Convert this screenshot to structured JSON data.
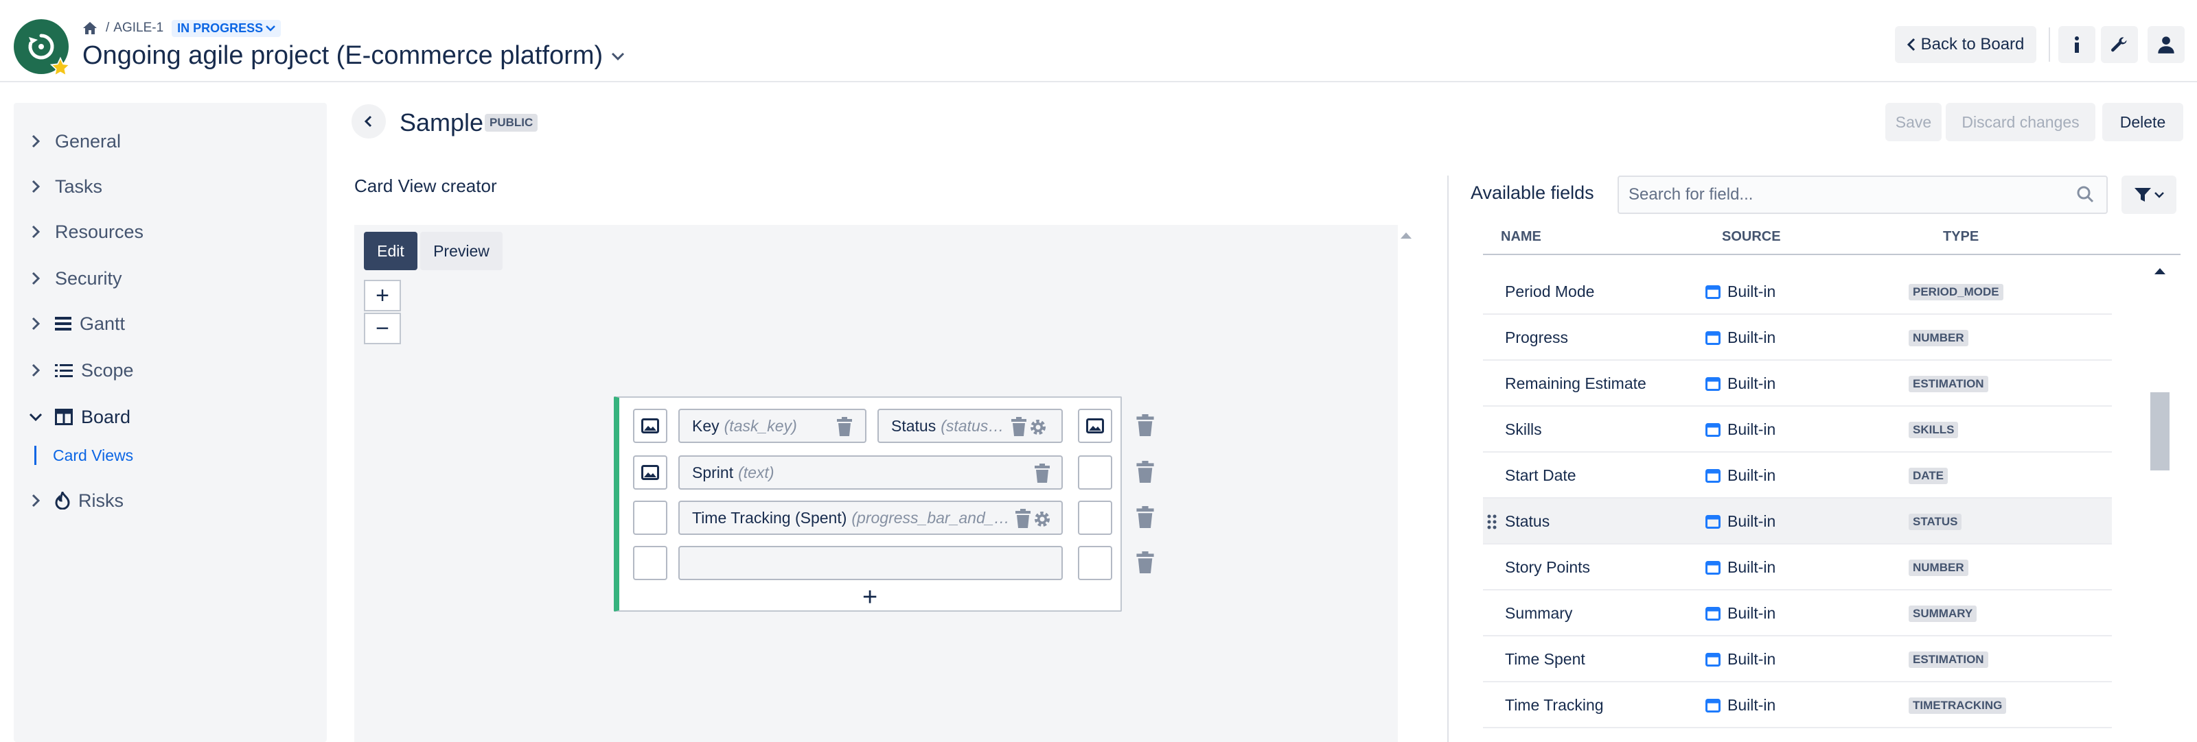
{
  "header": {
    "breadcrumb_sep": "/",
    "project_key": "AGILE-1",
    "status": "IN PROGRESS",
    "project_title": "Ongoing agile project (E-commerce platform)",
    "back_to_board": "Back to Board",
    "icons": [
      "home-icon",
      "info-icon",
      "wrench-icon",
      "user-icon"
    ]
  },
  "sidebar": {
    "items": [
      {
        "label": "General",
        "icon": null
      },
      {
        "label": "Tasks",
        "icon": null
      },
      {
        "label": "Resources",
        "icon": null
      },
      {
        "label": "Security",
        "icon": null
      },
      {
        "label": "Gantt",
        "icon": "gantt-icon"
      },
      {
        "label": "Scope",
        "icon": "list-icon"
      },
      {
        "label": "Board",
        "icon": "board-icon",
        "expanded": true
      },
      {
        "label": "Risks",
        "icon": "fire-icon"
      }
    ],
    "sub_item": "Card Views"
  },
  "editor": {
    "view_name": "Sample",
    "visibility": "PUBLIC",
    "save": "Save",
    "discard": "Discard changes",
    "delete": "Delete",
    "creator_label": "Card View creator",
    "tabs": {
      "edit": "Edit",
      "preview": "Preview"
    },
    "zoom_in": "+",
    "zoom_out": "−",
    "add_row": "+",
    "card": {
      "rows": [
        {
          "fields": [
            {
              "name": "Key",
              "type": "(task_key)",
              "settings": false
            },
            {
              "name": "Status",
              "type": "(status_…",
              "settings": true
            }
          ]
        },
        {
          "fields": [
            {
              "name": "Sprint",
              "type": "(text)",
              "settings": false
            }
          ]
        },
        {
          "fields": [
            {
              "name": "Time Tracking (Spent)",
              "type": "(progress_bar_and_p…",
              "settings": true
            }
          ]
        },
        {
          "fields": []
        }
      ]
    }
  },
  "fields_panel": {
    "title": "Available fields",
    "search_placeholder": "Search for field...",
    "columns": {
      "name": "NAME",
      "source": "SOURCE",
      "type": "TYPE"
    },
    "rows": [
      {
        "name": "Period Mode",
        "source": "Built-in",
        "type": "PERIOD_MODE"
      },
      {
        "name": "Progress",
        "source": "Built-in",
        "type": "NUMBER"
      },
      {
        "name": "Remaining Estimate",
        "source": "Built-in",
        "type": "ESTIMATION"
      },
      {
        "name": "Skills",
        "source": "Built-in",
        "type": "SKILLS"
      },
      {
        "name": "Start Date",
        "source": "Built-in",
        "type": "DATE"
      },
      {
        "name": "Status",
        "source": "Built-in",
        "type": "STATUS",
        "hovered": true
      },
      {
        "name": "Story Points",
        "source": "Built-in",
        "type": "NUMBER"
      },
      {
        "name": "Summary",
        "source": "Built-in",
        "type": "SUMMARY"
      },
      {
        "name": "Time Spent",
        "source": "Built-in",
        "type": "ESTIMATION"
      },
      {
        "name": "Time Tracking",
        "source": "Built-in",
        "type": "TIMETRACKING"
      }
    ]
  },
  "colors": {
    "brand": "#1f6d4f",
    "accent": "#0c66e4",
    "card_stripe": "#36b37e",
    "tab_active": "#344563"
  }
}
